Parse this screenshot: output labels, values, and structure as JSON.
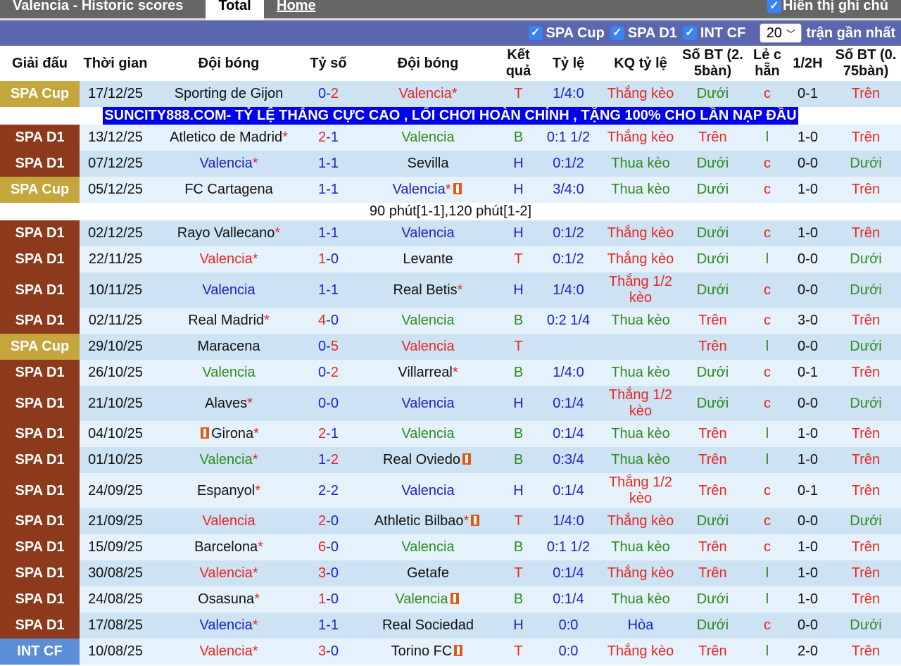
{
  "header": {
    "title": "Valencia - Historic scores",
    "tabs": [
      "Total",
      "Home"
    ],
    "show_notes": "Hiển thị ghi chú"
  },
  "filters": {
    "leagues": [
      "SPA Cup",
      "SPA D1",
      "INT CF"
    ],
    "count": "20",
    "count_suffix": "trận gần nhất"
  },
  "columns": [
    "Giải đấu",
    "Thời gian",
    "Đội bóng",
    "Tỷ số",
    "Đội bóng",
    "Kết quả",
    "Tỷ lệ",
    "KQ tỷ lệ",
    "Số BT (2. 5bàn)",
    "Lẻ c hẵn",
    "1/2H",
    "Số BT (0. 75bàn)"
  ],
  "colors": {
    "SPA Cup": "#c4a63c",
    "SPA D1": "#8c3a1b",
    "INT CF": "#5b8ed8"
  },
  "banner": "SUNCITY888.COM- TỶ LỆ THẮNG CỰC CAO , LỐI CHƠI HOÀN CHỈNH , TẶNG 100% CHO LẦN NẠP ĐẦU",
  "matches": [
    {
      "league": "SPA Cup",
      "date": "17/12/25",
      "home": "Sporting de Gijon",
      "hs": "",
      "hrc": false,
      "hg": "0",
      "ag": "2",
      "away": "Valencia",
      "as": "*",
      "arc": false,
      "vside": "a",
      "res": "T",
      "odds": "1/4:0",
      "kq": "Thắng kèo",
      "ou": "Dưới",
      "oe": "c",
      "half": "0-1",
      "ou2": "Trên"
    },
    {
      "league": "SPA D1",
      "date": "13/12/25",
      "home": "Atletico de Madrid",
      "hs": "*",
      "hg": "2",
      "ag": "1",
      "away": "Valencia",
      "as": "",
      "vside": "a",
      "res": "B",
      "odds": "0:1 1/2",
      "kq": "Thắng kèo",
      "ou": "Trên",
      "oe": "l",
      "half": "1-0",
      "ou2": "Trên"
    },
    {
      "league": "SPA D1",
      "date": "07/12/25",
      "home": "Valencia",
      "hs": "*",
      "hg": "1",
      "ag": "1",
      "away": "Sevilla",
      "as": "",
      "vside": "h",
      "res": "H",
      "odds": "0:1/2",
      "kq": "Thua kèo",
      "ou": "Dưới",
      "oe": "c",
      "half": "0-0",
      "ou2": "Dưới"
    },
    {
      "league": "SPA Cup",
      "date": "05/12/25",
      "home": "FC Cartagena",
      "hs": "",
      "hg": "1",
      "ag": "1",
      "away": "Valencia",
      "as": "*",
      "arc": true,
      "vside": "a",
      "res": "H",
      "odds": "3/4:0",
      "kq": "Thua kèo",
      "ou": "Dưới",
      "oe": "c",
      "half": "1-0",
      "ou2": "Trên",
      "note": "90 phút[1-1],120 phút[1-2]"
    },
    {
      "league": "SPA D1",
      "date": "02/12/25",
      "home": "Rayo Vallecano",
      "hs": "*",
      "hg": "1",
      "ag": "1",
      "away": "Valencia",
      "as": "",
      "vside": "a",
      "res": "H",
      "odds": "0:1/2",
      "kq": "Thắng kèo",
      "ou": "Dưới",
      "oe": "c",
      "half": "1-0",
      "ou2": "Trên"
    },
    {
      "league": "SPA D1",
      "date": "22/11/25",
      "home": "Valencia",
      "hs": "*",
      "hg": "1",
      "ag": "0",
      "away": "Levante",
      "as": "",
      "vside": "h",
      "res": "T",
      "odds": "0:1/2",
      "kq": "Thắng kèo",
      "ou": "Dưới",
      "oe": "l",
      "half": "0-0",
      "ou2": "Dưới"
    },
    {
      "league": "SPA D1",
      "date": "10/11/25",
      "home": "Valencia",
      "hs": "",
      "hg": "1",
      "ag": "1",
      "away": "Real Betis",
      "as": "*",
      "vside": "h",
      "res": "H",
      "odds": "1/4:0",
      "kq": "Thắng 1/2 kèo",
      "ou": "Dưới",
      "oe": "c",
      "half": "0-0",
      "ou2": "Dưới"
    },
    {
      "league": "SPA D1",
      "date": "02/11/25",
      "home": "Real Madrid",
      "hs": "*",
      "hg": "4",
      "ag": "0",
      "away": "Valencia",
      "as": "",
      "vside": "a",
      "res": "B",
      "odds": "0:2 1/4",
      "kq": "Thua kèo",
      "ou": "Trên",
      "oe": "c",
      "half": "3-0",
      "ou2": "Trên"
    },
    {
      "league": "SPA Cup",
      "date": "29/10/25",
      "home": "Maracena",
      "hs": "",
      "hg": "0",
      "ag": "5",
      "away": "Valencia",
      "as": "",
      "vside": "a",
      "res": "T",
      "odds": "",
      "kq": "",
      "ou": "Trên",
      "oe": "l",
      "half": "0-0",
      "ou2": "Dưới"
    },
    {
      "league": "SPA D1",
      "date": "26/10/25",
      "home": "Valencia",
      "hs": "",
      "hg": "0",
      "ag": "2",
      "away": "Villarreal",
      "as": "*",
      "vside": "h",
      "res": "B",
      "odds": "1/4:0",
      "kq": "Thua kèo",
      "ou": "Dưới",
      "oe": "c",
      "half": "0-1",
      "ou2": "Trên"
    },
    {
      "league": "SPA D1",
      "date": "21/10/25",
      "home": "Alaves",
      "hs": "*",
      "hg": "0",
      "ag": "0",
      "away": "Valencia",
      "as": "",
      "vside": "a",
      "res": "H",
      "odds": "0:1/4",
      "kq": "Thắng 1/2 kèo",
      "ou": "Dưới",
      "oe": "c",
      "half": "0-0",
      "ou2": "Dưới"
    },
    {
      "league": "SPA D1",
      "date": "04/10/25",
      "home": "Girona",
      "hs": "*",
      "hrc": true,
      "hg": "2",
      "ag": "1",
      "away": "Valencia",
      "as": "",
      "vside": "a",
      "res": "B",
      "odds": "0:1/4",
      "kq": "Thua kèo",
      "ou": "Trên",
      "oe": "l",
      "half": "1-0",
      "ou2": "Trên"
    },
    {
      "league": "SPA D1",
      "date": "01/10/25",
      "home": "Valencia",
      "hs": "*",
      "hg": "1",
      "ag": "2",
      "away": "Real Oviedo",
      "as": "",
      "arc": true,
      "vside": "h",
      "res": "B",
      "odds": "0:3/4",
      "kq": "Thua kèo",
      "ou": "Trên",
      "oe": "l",
      "half": "1-0",
      "ou2": "Trên"
    },
    {
      "league": "SPA D1",
      "date": "24/09/25",
      "home": "Espanyol",
      "hs": "*",
      "hg": "2",
      "ag": "2",
      "away": "Valencia",
      "as": "",
      "vside": "a",
      "res": "H",
      "odds": "0:1/4",
      "kq": "Thắng 1/2 kèo",
      "ou": "Trên",
      "oe": "c",
      "half": "0-1",
      "ou2": "Trên"
    },
    {
      "league": "SPA D1",
      "date": "21/09/25",
      "home": "Valencia",
      "hs": "",
      "hg": "2",
      "ag": "0",
      "away": "Athletic Bilbao",
      "as": "*",
      "arc": true,
      "vside": "h",
      "res": "T",
      "odds": "1/4:0",
      "kq": "Thắng kèo",
      "ou": "Dưới",
      "oe": "c",
      "half": "0-0",
      "ou2": "Dưới"
    },
    {
      "league": "SPA D1",
      "date": "15/09/25",
      "home": "Barcelona",
      "hs": "*",
      "hg": "6",
      "ag": "0",
      "away": "Valencia",
      "as": "",
      "vside": "a",
      "res": "B",
      "odds": "0:1 1/2",
      "kq": "Thua kèo",
      "ou": "Trên",
      "oe": "c",
      "half": "1-0",
      "ou2": "Trên"
    },
    {
      "league": "SPA D1",
      "date": "30/08/25",
      "home": "Valencia",
      "hs": "*",
      "hg": "3",
      "ag": "0",
      "away": "Getafe",
      "as": "",
      "vside": "h",
      "res": "T",
      "odds": "0:1/4",
      "kq": "Thắng kèo",
      "ou": "Trên",
      "oe": "l",
      "half": "1-0",
      "ou2": "Trên"
    },
    {
      "league": "SPA D1",
      "date": "24/08/25",
      "home": "Osasuna",
      "hs": "*",
      "hg": "1",
      "ag": "0",
      "away": "Valencia",
      "as": "",
      "arc": true,
      "vside": "a",
      "res": "B",
      "odds": "0:1/4",
      "kq": "Thua kèo",
      "ou": "Dưới",
      "oe": "l",
      "half": "1-0",
      "ou2": "Trên"
    },
    {
      "league": "SPA D1",
      "date": "17/08/25",
      "home": "Valencia",
      "hs": "*",
      "hg": "1",
      "ag": "1",
      "away": "Real Sociedad",
      "as": "",
      "vside": "h",
      "res": "H",
      "odds": "0:0",
      "kq": "Hòa",
      "ou": "Dưới",
      "oe": "c",
      "half": "0-0",
      "ou2": "Dưới"
    },
    {
      "league": "INT CF",
      "date": "10/08/25",
      "home": "Valencia",
      "hs": "*",
      "hg": "3",
      "ag": "0",
      "away": "Torino FC",
      "as": "",
      "arc": true,
      "vside": "h",
      "res": "T",
      "odds": "0:0",
      "kq": "Thắng kèo",
      "ou": "Trên",
      "oe": "l",
      "half": "2-0",
      "ou2": "Trên"
    }
  ]
}
